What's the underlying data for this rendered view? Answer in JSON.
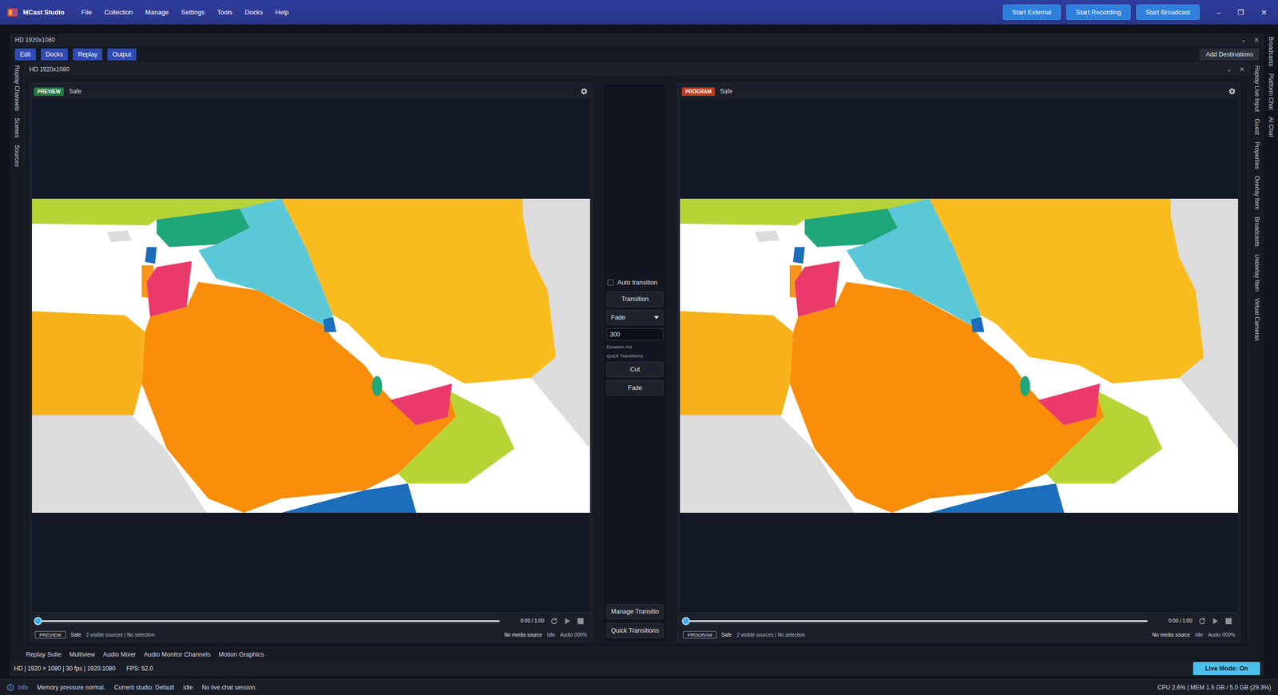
{
  "app": {
    "title": "MCast Studio",
    "menu": [
      "File",
      "Collection",
      "Manage",
      "Settings",
      "Tools",
      "Docks",
      "Help"
    ],
    "actions": [
      "Start External",
      "Start Recording",
      "Start Broadcast"
    ],
    "window_controls": [
      "–",
      "❐",
      "✕"
    ]
  },
  "outer_dock": {
    "title": "HD 1920x1080",
    "controls": [
      "⌄",
      "✕"
    ]
  },
  "toolbar": {
    "buttons": [
      "Edit",
      "Docks",
      "Replay",
      "Output"
    ],
    "add_destinations": "Add Destinations"
  },
  "inner_dock": {
    "title": "HD 1920x1080",
    "controls": [
      "⌄",
      "✕"
    ]
  },
  "left_tabs": [
    "Replay Channels",
    "Scenes",
    "Sources"
  ],
  "right_tabs_inner": [
    "Replay Live Input",
    "Guest",
    "Properties",
    "Overlay Item",
    "Broadcasts",
    "Underlay Item",
    "Virtual Cameras"
  ],
  "right_tabs_outer": [
    "Broadcasts",
    "Platform Chat",
    "AI Chat"
  ],
  "preview": {
    "badge": "PREVIEW",
    "color": "#1f7a3e",
    "safe": "Safe",
    "level": 0,
    "time": "0:00 / 1:00",
    "status_badge": "PREVIEW",
    "status_safe": "Safe",
    "sources": "2 visible sources | No selection",
    "media": "No media source",
    "state": "Idle",
    "audio": "Audio 000%"
  },
  "program": {
    "badge": "PROGRAM",
    "color": "#c0391b",
    "safe": "Safe",
    "level": 0,
    "time": "0:00 / 1:00",
    "status_badge": "PROGRAM",
    "status_safe": "Safe",
    "sources": "2 visible sources | No selection",
    "media": "No media source",
    "state": "Idle",
    "audio": "Audio 000%"
  },
  "transitions": {
    "auto_transition": {
      "label": "Auto transition",
      "checked": false
    },
    "transition_button": "Transition",
    "type": "Fade",
    "duration": "300",
    "duration_label": "Duration ms",
    "quick_label": "Quick Transitions",
    "quick": [
      "Cut",
      "Fade"
    ],
    "manage": "Manage Transitio",
    "quick_transitions": "Quick Transitions"
  },
  "bottom_tabs": [
    "Replay Suite",
    "Multiview",
    "Audio Mixer",
    "Audio Monitor Channels",
    "Motion Graphics"
  ],
  "info_bar": {
    "format": "HD | 1920 × 1080 | 30 fps | 1920:1080",
    "fps": "FPS: 52.0",
    "live_mode": "Live Mode: On"
  },
  "status_bar": {
    "level": "Info",
    "message": "Memory pressure normal.",
    "studio": "Current studio: Default",
    "state": "Idle",
    "chat": "No live chat session.",
    "resources": "CPU 2.6% | MEM 1.5 GB / 5.0 GB (29.3%)"
  }
}
